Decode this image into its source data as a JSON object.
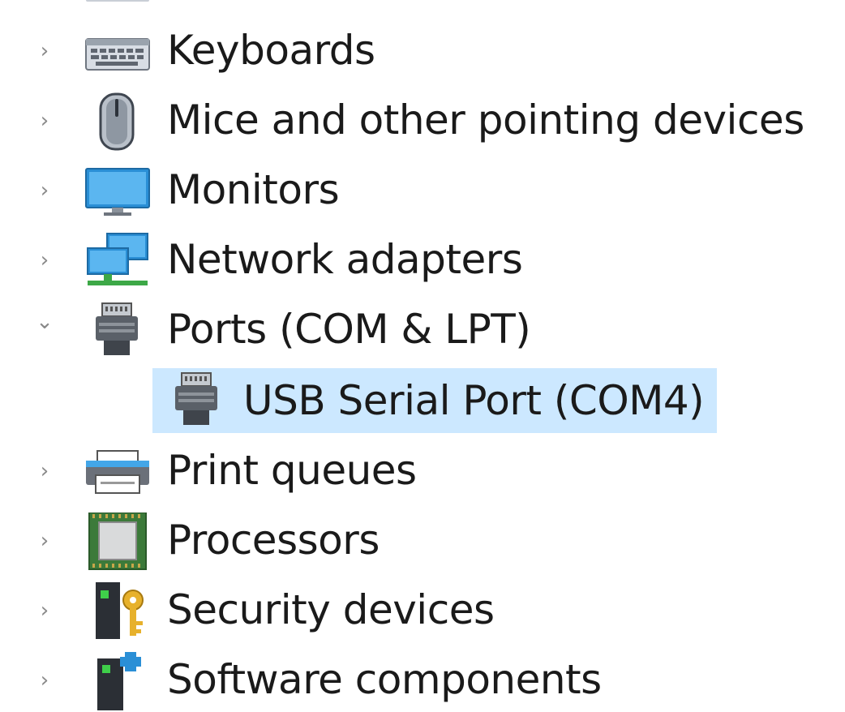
{
  "tree": {
    "items": [
      {
        "label": "Keyboards",
        "icon": "keyboard-icon",
        "expanded": false,
        "level": 0
      },
      {
        "label": "Mice and other pointing devices",
        "icon": "mouse-icon",
        "expanded": false,
        "level": 0
      },
      {
        "label": "Monitors",
        "icon": "monitor-icon",
        "expanded": false,
        "level": 0
      },
      {
        "label": "Network adapters",
        "icon": "network-adapter-icon",
        "expanded": false,
        "level": 0
      },
      {
        "label": "Ports (COM & LPT)",
        "icon": "port-icon",
        "expanded": true,
        "level": 0
      },
      {
        "label": "USB Serial Port (COM4)",
        "icon": "port-icon",
        "selected": true,
        "level": 1
      },
      {
        "label": "Print queues",
        "icon": "printer-icon",
        "expanded": false,
        "level": 0
      },
      {
        "label": "Processors",
        "icon": "processor-icon",
        "expanded": false,
        "level": 0
      },
      {
        "label": "Security devices",
        "icon": "security-device-icon",
        "expanded": false,
        "level": 0
      },
      {
        "label": "Software components",
        "icon": "software-component-icon",
        "expanded": false,
        "level": 0
      }
    ],
    "chevron_collapsed": "›",
    "chevron_expanded": "⌄"
  },
  "colors": {
    "selection": "#cce8ff",
    "text": "#1a1a1a",
    "chevron": "#8a8a8a"
  }
}
